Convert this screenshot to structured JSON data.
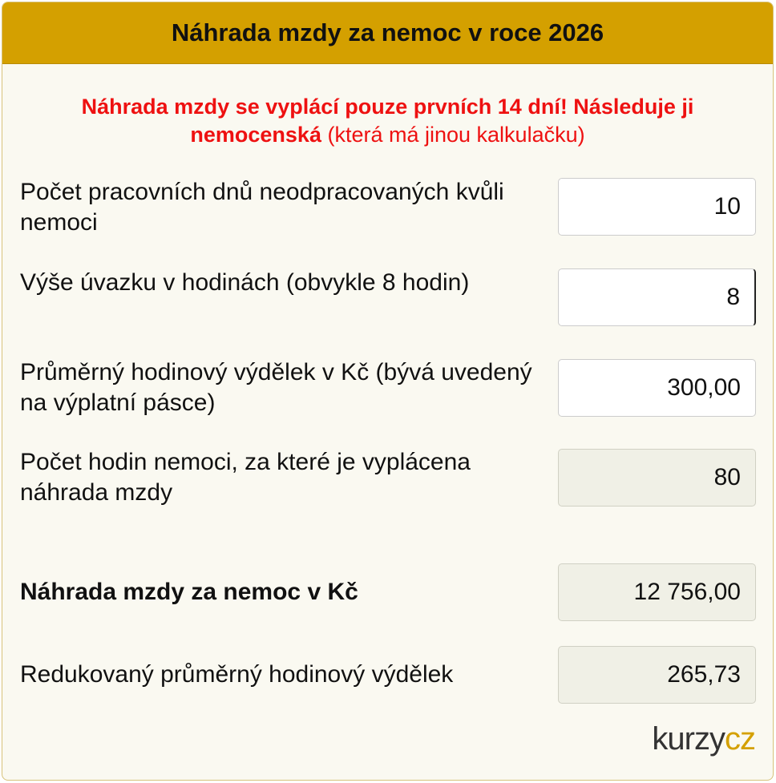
{
  "header": {
    "title": "Náhrada mzdy za nemoc v roce 2026"
  },
  "warning": {
    "bold_text": "Náhrada mzdy se vyplácí pouze prvních 14 dní! Následuje ji nemocenská",
    "normal_text": " (která má jinou kalkulačku)"
  },
  "fields": [
    {
      "label": "Počet pracovních dnů neodpracovaných kvůli nemoci",
      "value": "10"
    },
    {
      "label": "Výše úvazku v hodinách (obvykle 8 hodin)",
      "value": "8"
    },
    {
      "label": "Průměrný hodinový výdělek v Kč (bývá uvedený na výplatní pásce)",
      "value": "300,00"
    },
    {
      "label": "Počet hodin nemoci, za které je vyplácena náhrada mzdy",
      "value": "80"
    },
    {
      "label": "Náhrada mzdy za nemoc v Kč",
      "value": "12 756,00"
    },
    {
      "label": "Redukovaný průměrný hodinový výdělek",
      "value": "265,73"
    }
  ],
  "logo": {
    "part1": "kurzy",
    "part2": "cz"
  },
  "colors": {
    "accent": "#d4a000",
    "warning": "#ee1111",
    "readonly_bg": "#f0f0e6"
  }
}
